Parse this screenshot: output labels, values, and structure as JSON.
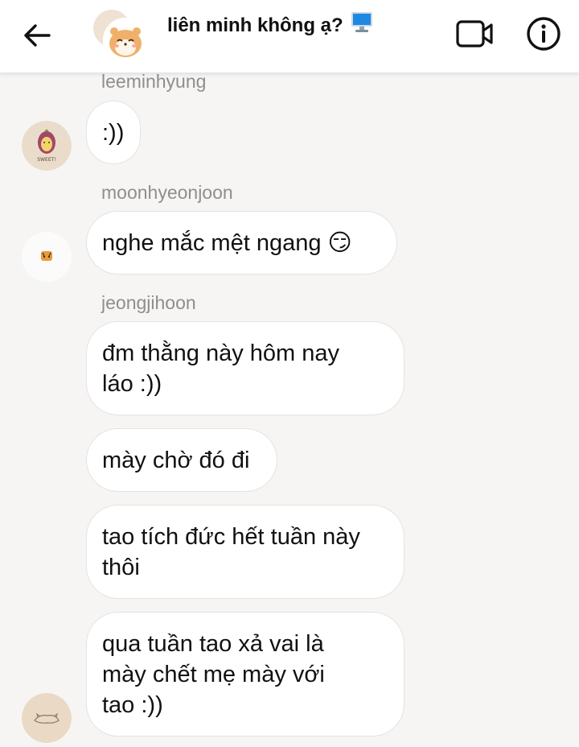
{
  "header": {
    "title": "liên minh không ạ?",
    "title_emoji": "desktop-computer-emoji"
  },
  "messages": [
    {
      "sender": "leeminhyung",
      "text": ":))"
    },
    {
      "sender": "moonhyeonjoon",
      "text": "nghe mắc mệt ngang 😏"
    },
    {
      "sender": "jeongjihoon",
      "text": "đm thằng này hôm nay\nláo :))"
    },
    {
      "text": "mày chờ đó đi"
    },
    {
      "text": "tao tích đức hết tuần này\nthôi"
    },
    {
      "text": "qua tuần tao xả vai là\nmày chết mẹ mày với\ntao :))"
    }
  ],
  "colors": {
    "background": "#f7f5f3",
    "bubble": "#ffffff",
    "bubble_border": "#e3e3e3",
    "sender_text": "#8e8e8e"
  }
}
